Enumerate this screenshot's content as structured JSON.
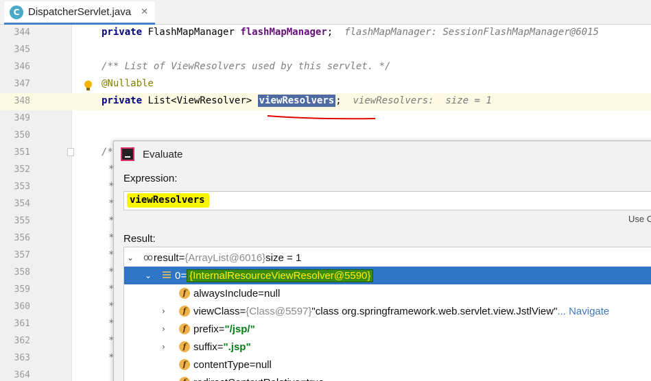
{
  "tab": {
    "icon_letter": "C",
    "label": "DispatcherServlet.java",
    "close": "✕"
  },
  "gutter": {
    "line_numbers": [
      "344",
      "345",
      "346",
      "347",
      "348",
      "349",
      "350",
      "351",
      "352",
      "353",
      "354",
      "355",
      "356",
      "357",
      "358",
      "359",
      "360",
      "361",
      "362",
      "363",
      "364"
    ]
  },
  "code": {
    "l344": {
      "kw": "private",
      "type": "FlashMapManager",
      "field": "flashMapManager",
      "semi": ";",
      "hint": "flashMapManager: SessionFlashMapManager@6015"
    },
    "l346": {
      "comment": "/** List of ViewResolvers used by this servlet. */"
    },
    "l347": {
      "annotation": "@Nullable"
    },
    "l348": {
      "kw": "private",
      "type": "List<ViewResolver>",
      "field": "viewResolvers",
      "semi": ";",
      "hint": "viewResolvers:  size = 1"
    },
    "l351": {
      "text": "/*"
    },
    "star": "*"
  },
  "dialog": {
    "title": "Evaluate",
    "expression_label": "Expression:",
    "expression_value": "viewResolvers",
    "use_label": "Use C",
    "result_label": "Result:",
    "tree": {
      "root": {
        "name": "result",
        "eq": " = ",
        "ref": "{ArrayList@6016}",
        "extra": "  size = 1"
      },
      "item0": {
        "name": "0",
        "eq": " = ",
        "ref": "{InternalResourceViewResolver@5590}"
      },
      "fields": [
        {
          "icon": "f",
          "name": "alwaysInclude",
          "eq": " = ",
          "value": "null"
        },
        {
          "icon": "f",
          "name": "viewClass",
          "eq": " = ",
          "ref": "{Class@5597}",
          "value": " \"class org.springframework.web.servlet.view.JstlView\"",
          "more": "... Navigate"
        },
        {
          "icon": "f",
          "name": "prefix",
          "eq": " = ",
          "value": "\"/jsp/\""
        },
        {
          "icon": "f",
          "name": "suffix",
          "eq": " = ",
          "value": "\".jsp\""
        },
        {
          "icon": "f",
          "name": "contentType",
          "eq": " = ",
          "value": "null"
        },
        {
          "icon": "f",
          "name": "redirectContextRelative",
          "eq": " = ",
          "value": "true"
        }
      ]
    }
  },
  "colors": {
    "selection": "#2e75c5",
    "highlight_yellow": "#f7f500",
    "highlight_green": "#3a8d12",
    "annotation_red": "#e00000"
  }
}
